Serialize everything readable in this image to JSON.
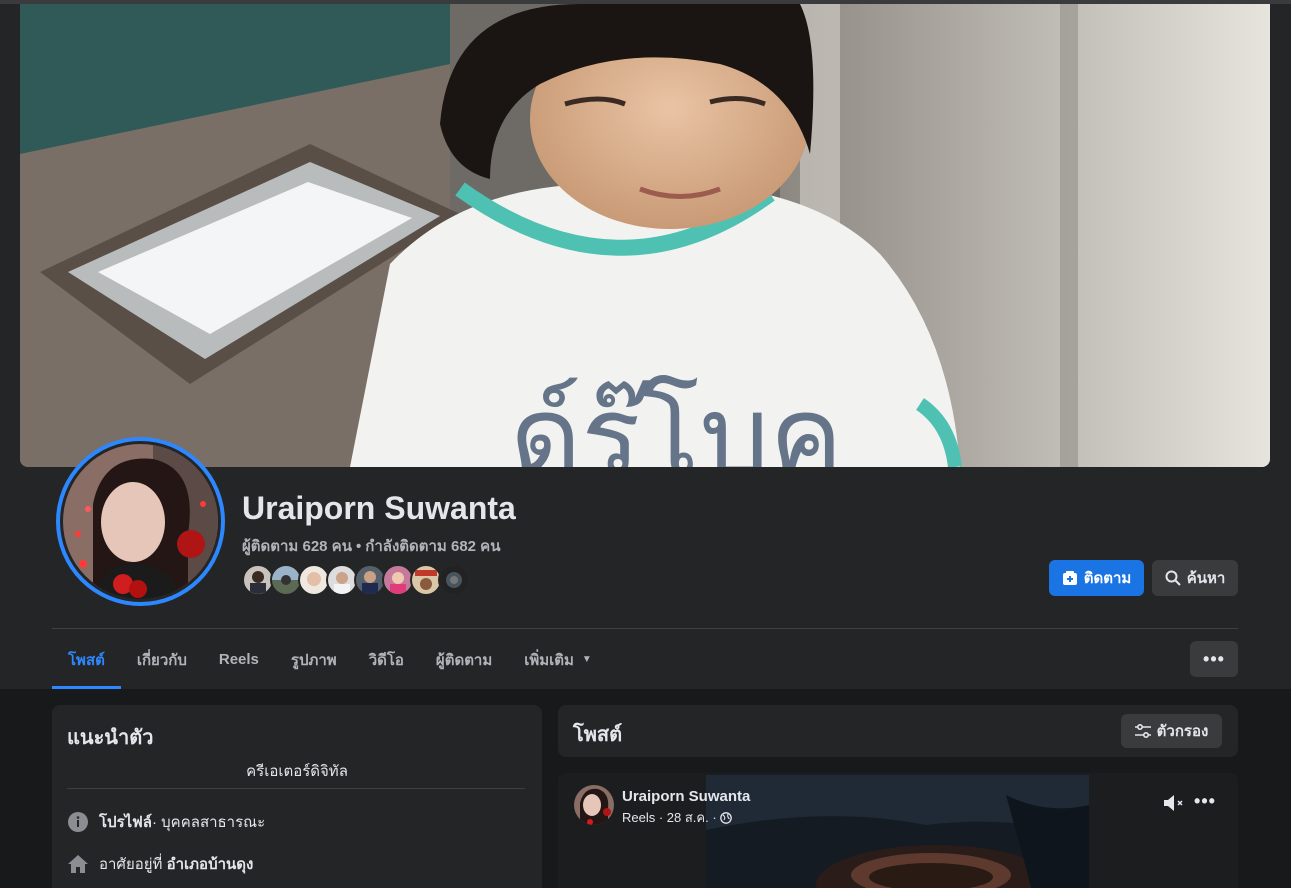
{
  "profile": {
    "name": "Uraiporn Suwanta",
    "followers_text": "ผู้ติดตาม 628 คน",
    "following_text": "กำลังติดตาม 682 คน",
    "separator": "•"
  },
  "actions": {
    "follow_label": "ติดตาม",
    "search_label": "ค้นหา"
  },
  "tabs": [
    {
      "label": "โพสต์",
      "active": true
    },
    {
      "label": "เกี่ยวกับ",
      "active": false
    },
    {
      "label": "Reels",
      "active": false
    },
    {
      "label": "รูปภาพ",
      "active": false
    },
    {
      "label": "วิดีโอ",
      "active": false
    },
    {
      "label": "ผู้ติดตาม",
      "active": false
    },
    {
      "label": "เพิ่มเติม",
      "active": false
    }
  ],
  "intro": {
    "title": "แนะนำตัว",
    "bio": "ครีเอเตอร์ดิจิทัล",
    "profile_label": "โปรไฟล์",
    "profile_value": " · บุคคลสาธารณะ",
    "lives_prefix": "อาศัยอยู่ที่ ",
    "lives_value": "อำเภอบ้านดุง"
  },
  "posts": {
    "title": "โพสต์",
    "filter_label": "ตัวกรอง"
  },
  "reel_post": {
    "author": "Uraiporn Suwanta",
    "meta": "Reels · 28 ส.ค. ·"
  },
  "colors": {
    "accent": "#2d88ff",
    "button_primary": "#1b74e4",
    "surface": "#242526",
    "background": "#18191a"
  },
  "icons": {
    "follow": "add-friend-icon",
    "search": "search-icon",
    "more": "more-horizontal-icon",
    "filter": "filter-sliders-icon",
    "info": "info-icon",
    "home": "home-icon",
    "mute": "muted-speaker-icon",
    "globe": "globe-icon"
  }
}
